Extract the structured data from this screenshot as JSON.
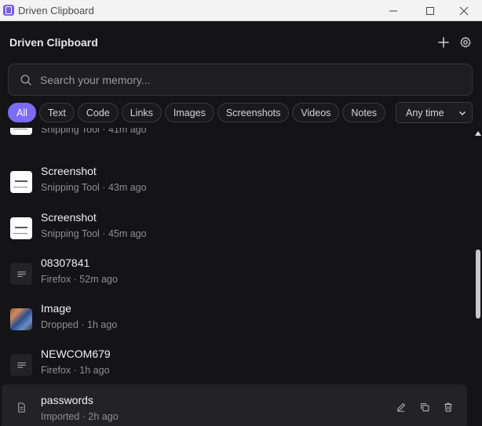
{
  "window": {
    "title": "Driven Clipboard"
  },
  "header": {
    "name": "Driven Clipboard"
  },
  "search": {
    "placeholder": "Search your memory..."
  },
  "filters": [
    "All",
    "Text",
    "Code",
    "Links",
    "Images",
    "Screenshots",
    "Videos",
    "Notes"
  ],
  "active_filter": "All",
  "time_filter": {
    "selected": "Any time"
  },
  "items": [
    {
      "title": "",
      "subtitle": "Snipping Tool · 41m ago",
      "kind": "screenshot"
    },
    {
      "title": "Screenshot",
      "subtitle": "Snipping Tool · 43m ago",
      "kind": "screenshot"
    },
    {
      "title": "Screenshot",
      "subtitle": "Snipping Tool · 45m ago",
      "kind": "screenshot"
    },
    {
      "title": "08307841",
      "subtitle": "Firefox · 52m ago",
      "kind": "text"
    },
    {
      "title": "Image",
      "subtitle": "Dropped · 1h ago",
      "kind": "image"
    },
    {
      "title": "NEWCOM679",
      "subtitle": "Firefox · 1h ago",
      "kind": "text"
    },
    {
      "title": "passwords",
      "subtitle": "Imported · 2h ago",
      "kind": "document"
    }
  ],
  "icons": {
    "app": "clipboard-icon",
    "add": "plus-icon",
    "settings": "gear-icon",
    "search": "search-icon",
    "text": "lines-icon",
    "document": "file-icon",
    "edit": "pencil-icon",
    "copy": "copy-icon",
    "delete": "trash-icon"
  },
  "colors": {
    "accent": "#7b6cf6",
    "background": "#141416"
  }
}
